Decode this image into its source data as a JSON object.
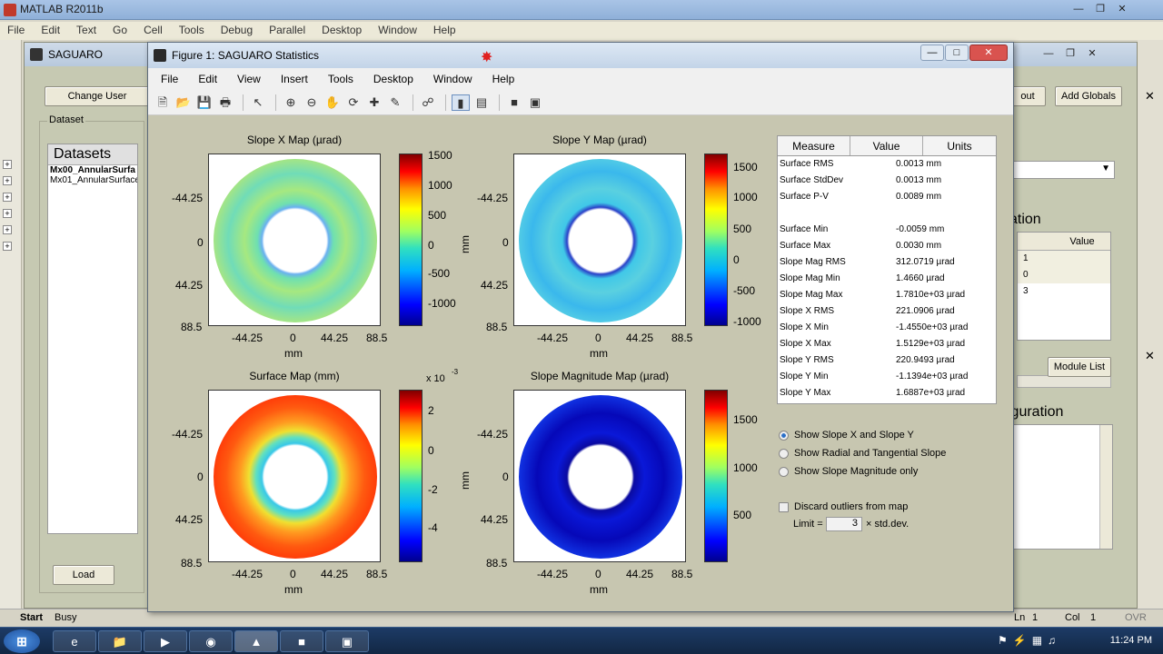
{
  "matlab": {
    "title": "MATLAB R2011b",
    "menu": [
      "File",
      "Edit",
      "Text",
      "Go",
      "Cell",
      "Tools",
      "Debug",
      "Parallel",
      "Desktop",
      "Window",
      "Help"
    ],
    "status_left": "Busy",
    "start_label": "Start",
    "ln_label": "Ln",
    "ln_value": "1",
    "col_label": "Col",
    "col_value": "1",
    "ovr_label": "OVR"
  },
  "saguaro": {
    "title": "SAGUARO",
    "change_user": "Change User",
    "out_button": "out",
    "add_globals": "Add Globals",
    "dataset_group": "Dataset",
    "datasets_header": "Datasets",
    "datasets": [
      "Mx00_AnnularSurfa",
      "Mx01_AnnularSurface"
    ],
    "load_button": "Load",
    "right_caption": "ation",
    "value_header": "Value",
    "values": [
      "1",
      "0",
      "3"
    ],
    "module_list": "Module List",
    "config_caption": "iguration"
  },
  "figure": {
    "title": "Figure 1: SAGUARO Statistics",
    "menu": [
      "File",
      "Edit",
      "View",
      "Insert",
      "Tools",
      "Desktop",
      "Window",
      "Help"
    ],
    "plots": [
      {
        "title": "Slope X Map (µrad)",
        "cbar_ticks": [
          "1500",
          "1000",
          "500",
          "0",
          "-500",
          "-1000"
        ],
        "cbar_label": "mm",
        "exponent": ""
      },
      {
        "title": "Slope Y Map (µrad)",
        "cbar_ticks": [
          "1500",
          "1000",
          "500",
          "0",
          "-500",
          "-1000"
        ],
        "cbar_label": "",
        "exponent": ""
      },
      {
        "title": "Surface Map (mm)",
        "cbar_ticks": [
          "2",
          "0",
          "-2",
          "-4"
        ],
        "cbar_label": "mm",
        "exponent": "x 10"
      },
      {
        "title": "Slope Magnitude Map (µrad)",
        "cbar_ticks": [
          "1500",
          "1000",
          "500"
        ],
        "cbar_label": "",
        "exponent": ""
      }
    ],
    "exponent_power": "-3",
    "y_ticks": [
      "-44.25",
      "0",
      "44.25",
      "88.5"
    ],
    "x_ticks": [
      "-44.25",
      "0",
      "44.25",
      "88.5"
    ],
    "x_label": "mm",
    "stats": {
      "headers": [
        "Measure",
        "Value",
        "Units"
      ],
      "rows": [
        [
          "Surface RMS",
          "0.0013 mm"
        ],
        [
          "Surface StdDev",
          "0.0013 mm"
        ],
        [
          "Surface P-V",
          "0.0089 mm"
        ],
        [
          "",
          ""
        ],
        [
          "Surface Min",
          "-0.0059 mm"
        ],
        [
          "Surface Max",
          "0.0030 mm"
        ],
        [
          "Slope Mag RMS",
          "312.0719 µrad"
        ],
        [
          "Slope Mag Min",
          "1.4660 µrad"
        ],
        [
          "Slope Mag Max",
          "1.7810e+03 µrad"
        ],
        [
          "Slope X RMS",
          "221.0906 µrad"
        ],
        [
          "Slope X Min",
          "-1.4550e+03 µrad"
        ],
        [
          "Slope X Max",
          "1.5129e+03 µrad"
        ],
        [
          "Slope Y RMS",
          "220.9493 µrad"
        ],
        [
          "Slope Y Min",
          "-1.1394e+03 µrad"
        ],
        [
          "Slope Y Max",
          "1.6887e+03 µrad"
        ]
      ]
    },
    "radio_options": [
      "Show Slope X and Slope Y",
      "Show Radial and Tangential Slope",
      "Show Slope Magnitude only"
    ],
    "discard_label": "Discard outliers from map",
    "limit_label": "Limit =",
    "limit_value": "3",
    "limit_suffix": "× std.dev."
  },
  "taskbar": {
    "clock": "11:24 PM"
  }
}
